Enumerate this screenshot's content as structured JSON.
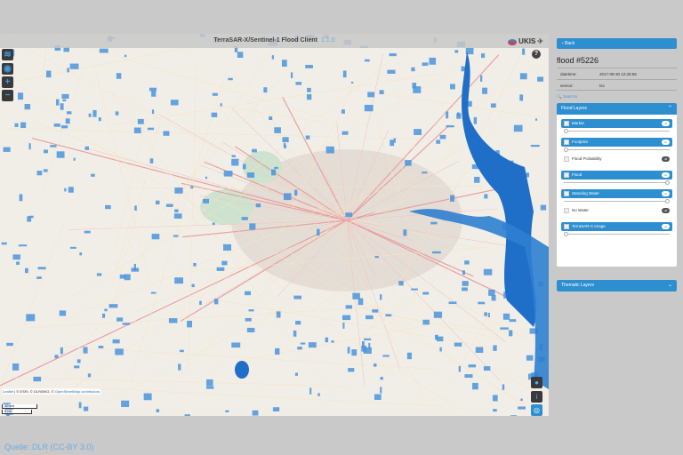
{
  "header": {
    "title": "TerraSAR-X/Sentinel-1 Flood Client",
    "version": "1.1.0",
    "logo": "UKIS"
  },
  "map_tools": [
    {
      "icon": "layers-icon"
    },
    {
      "icon": "globe-icon"
    },
    {
      "icon": "zoom-in-icon",
      "label": "+"
    },
    {
      "icon": "zoom-out-icon",
      "label": "−"
    }
  ],
  "map": {
    "attribution_link": "Leaflet",
    "attribution": "© ESRI, © DLR/BKG, © ",
    "osm": "OpenStreetMap contributors",
    "scale_km": "10 km",
    "scale_mi": "5 mi"
  },
  "panel": {
    "back": "Back",
    "title": "flood #5226",
    "info": [
      {
        "key": "datetime:",
        "value": "2017-08-30 12:25:56"
      },
      {
        "key": "sensor:",
        "value": "tsx"
      }
    ],
    "zoom_to": "zoom to",
    "flood_layers": {
      "title": "Flood Layers",
      "layers": [
        {
          "name": "Marker",
          "state": "on",
          "opacity": 0
        },
        {
          "name": "Footprint",
          "state": "on",
          "opacity": 0
        },
        {
          "name": "Flood Probability",
          "state": "off"
        },
        {
          "name": "Flood",
          "state": "on",
          "opacity": 1
        },
        {
          "name": "Standing Water",
          "state": "on",
          "opacity": 1
        },
        {
          "name": "No Water",
          "state": "off"
        },
        {
          "name": "TerraSAR-X Image",
          "state": "on",
          "opacity": 0
        }
      ]
    },
    "thematic_layers": {
      "title": "Thematic Layers"
    }
  },
  "source": "Quelle: DLR (CC-BY 3.0)",
  "colors": {
    "accent": "#2e8fd0",
    "water": "#3d8fd8"
  }
}
